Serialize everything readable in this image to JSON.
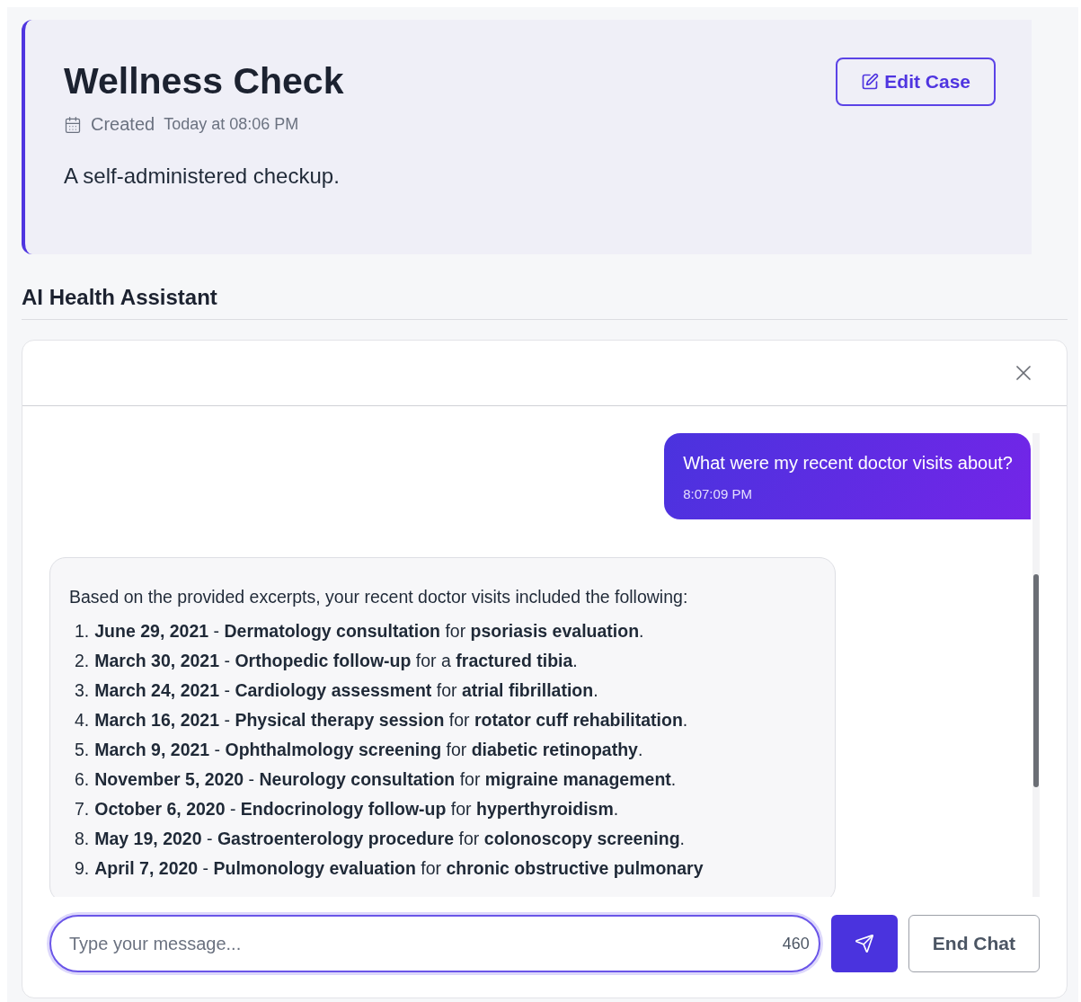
{
  "case": {
    "title": "Wellness Check",
    "created_label": "Created",
    "created_value": "Today at 08:06 PM",
    "description": "A self-administered checkup.",
    "edit_button": "Edit Case"
  },
  "assistant": {
    "title": "AI Health Assistant"
  },
  "messages": [
    {
      "kind": "user",
      "text": "What were my recent doctor visits about?",
      "time": "8:07:09 PM"
    },
    {
      "kind": "bot",
      "intro": "Based on the provided excerpts, your recent doctor visits included the following:",
      "items": [
        {
          "number": "1.",
          "text": "**June 29, 2021** - **Dermatology consultation** for **psoriasis evaluation**."
        },
        {
          "number": "2.",
          "text": "**March 30, 2021** - **Orthopedic follow-up** for a **fractured tibia**."
        },
        {
          "number": "3.",
          "text": "**March 24, 2021** - **Cardiology assessment** for **atrial fibrillation**."
        },
        {
          "number": "4.",
          "text": "**March 16, 2021** - **Physical therapy session** for **rotator cuff rehabilitation**."
        },
        {
          "number": "5.",
          "text": "**March 9, 2021** - **Ophthalmology screening** for **diabetic retinopathy**."
        },
        {
          "number": "6.",
          "text": "**November 5, 2020** - **Neurology consultation** for **migraine management**."
        },
        {
          "number": "7.",
          "text": "**October 6, 2020** - **Endocrinology follow-up** for **hyperthyroidism**."
        },
        {
          "number": "8.",
          "text": "**May 19, 2020** - **Gastroenterology procedure** for **colonoscopy screening**."
        },
        {
          "number": "9.",
          "text": "**April 7, 2020** - **Pulmonology evaluation** for **chronic obstructive pulmonary**"
        }
      ]
    }
  ],
  "composer": {
    "placeholder": "Type your message...",
    "counter": "460",
    "end_button": "End Chat"
  }
}
